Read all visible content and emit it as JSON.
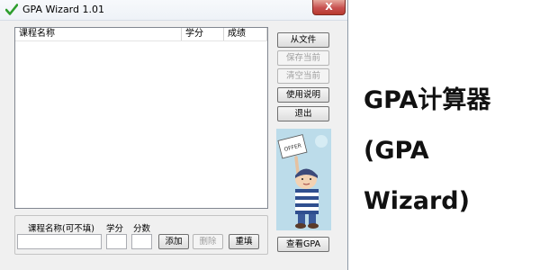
{
  "window": {
    "title": "GPA Wizard 1.01",
    "close_label": "X"
  },
  "course_list": {
    "columns": [
      "课程名称",
      "学分",
      "成绩"
    ],
    "rows": []
  },
  "buttons": {
    "from_file": "从文件",
    "save_current": "保存当前",
    "clear_current": "清空当前",
    "instructions": "使用说明",
    "exit": "退出",
    "view_gpa": "查看GPA"
  },
  "entry": {
    "course_name_label": "课程名称(可不填)",
    "credit_label": "学分",
    "score_label": "分数",
    "course_name_value": "",
    "credit_value": "",
    "score_value": "",
    "add_label": "添加",
    "delete_label": "删除",
    "reset_label": "重填"
  },
  "illustration": {
    "sign_text": "OFFER",
    "icon": "student-holding-sign"
  },
  "caption": {
    "line1": "GPA计算器",
    "line2": "(GPA",
    "line3": "Wizard)"
  },
  "colors": {
    "checkmark": "#2e9e2e",
    "close_button": "#c75050",
    "illustration_bg": "#bcdcea"
  }
}
